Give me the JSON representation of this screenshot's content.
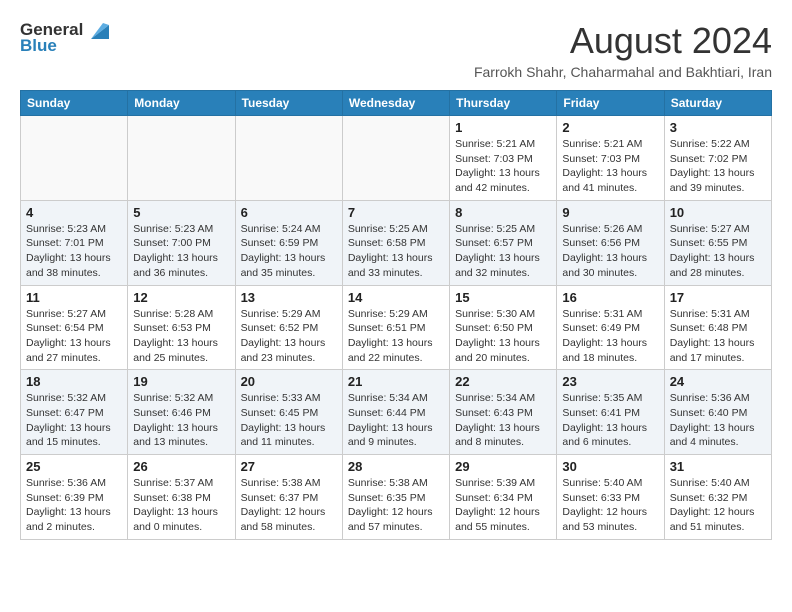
{
  "header": {
    "logo_general": "General",
    "logo_blue": "Blue",
    "month_title": "August 2024",
    "subtitle": "Farrokh Shahr, Chaharmahal and Bakhtiari, Iran"
  },
  "days_of_week": [
    "Sunday",
    "Monday",
    "Tuesday",
    "Wednesday",
    "Thursday",
    "Friday",
    "Saturday"
  ],
  "weeks": [
    [
      {
        "day": "",
        "info": ""
      },
      {
        "day": "",
        "info": ""
      },
      {
        "day": "",
        "info": ""
      },
      {
        "day": "",
        "info": ""
      },
      {
        "day": "1",
        "info": "Sunrise: 5:21 AM\nSunset: 7:03 PM\nDaylight: 13 hours\nand 42 minutes."
      },
      {
        "day": "2",
        "info": "Sunrise: 5:21 AM\nSunset: 7:03 PM\nDaylight: 13 hours\nand 41 minutes."
      },
      {
        "day": "3",
        "info": "Sunrise: 5:22 AM\nSunset: 7:02 PM\nDaylight: 13 hours\nand 39 minutes."
      }
    ],
    [
      {
        "day": "4",
        "info": "Sunrise: 5:23 AM\nSunset: 7:01 PM\nDaylight: 13 hours\nand 38 minutes."
      },
      {
        "day": "5",
        "info": "Sunrise: 5:23 AM\nSunset: 7:00 PM\nDaylight: 13 hours\nand 36 minutes."
      },
      {
        "day": "6",
        "info": "Sunrise: 5:24 AM\nSunset: 6:59 PM\nDaylight: 13 hours\nand 35 minutes."
      },
      {
        "day": "7",
        "info": "Sunrise: 5:25 AM\nSunset: 6:58 PM\nDaylight: 13 hours\nand 33 minutes."
      },
      {
        "day": "8",
        "info": "Sunrise: 5:25 AM\nSunset: 6:57 PM\nDaylight: 13 hours\nand 32 minutes."
      },
      {
        "day": "9",
        "info": "Sunrise: 5:26 AM\nSunset: 6:56 PM\nDaylight: 13 hours\nand 30 minutes."
      },
      {
        "day": "10",
        "info": "Sunrise: 5:27 AM\nSunset: 6:55 PM\nDaylight: 13 hours\nand 28 minutes."
      }
    ],
    [
      {
        "day": "11",
        "info": "Sunrise: 5:27 AM\nSunset: 6:54 PM\nDaylight: 13 hours\nand 27 minutes."
      },
      {
        "day": "12",
        "info": "Sunrise: 5:28 AM\nSunset: 6:53 PM\nDaylight: 13 hours\nand 25 minutes."
      },
      {
        "day": "13",
        "info": "Sunrise: 5:29 AM\nSunset: 6:52 PM\nDaylight: 13 hours\nand 23 minutes."
      },
      {
        "day": "14",
        "info": "Sunrise: 5:29 AM\nSunset: 6:51 PM\nDaylight: 13 hours\nand 22 minutes."
      },
      {
        "day": "15",
        "info": "Sunrise: 5:30 AM\nSunset: 6:50 PM\nDaylight: 13 hours\nand 20 minutes."
      },
      {
        "day": "16",
        "info": "Sunrise: 5:31 AM\nSunset: 6:49 PM\nDaylight: 13 hours\nand 18 minutes."
      },
      {
        "day": "17",
        "info": "Sunrise: 5:31 AM\nSunset: 6:48 PM\nDaylight: 13 hours\nand 17 minutes."
      }
    ],
    [
      {
        "day": "18",
        "info": "Sunrise: 5:32 AM\nSunset: 6:47 PM\nDaylight: 13 hours\nand 15 minutes."
      },
      {
        "day": "19",
        "info": "Sunrise: 5:32 AM\nSunset: 6:46 PM\nDaylight: 13 hours\nand 13 minutes."
      },
      {
        "day": "20",
        "info": "Sunrise: 5:33 AM\nSunset: 6:45 PM\nDaylight: 13 hours\nand 11 minutes."
      },
      {
        "day": "21",
        "info": "Sunrise: 5:34 AM\nSunset: 6:44 PM\nDaylight: 13 hours\nand 9 minutes."
      },
      {
        "day": "22",
        "info": "Sunrise: 5:34 AM\nSunset: 6:43 PM\nDaylight: 13 hours\nand 8 minutes."
      },
      {
        "day": "23",
        "info": "Sunrise: 5:35 AM\nSunset: 6:41 PM\nDaylight: 13 hours\nand 6 minutes."
      },
      {
        "day": "24",
        "info": "Sunrise: 5:36 AM\nSunset: 6:40 PM\nDaylight: 13 hours\nand 4 minutes."
      }
    ],
    [
      {
        "day": "25",
        "info": "Sunrise: 5:36 AM\nSunset: 6:39 PM\nDaylight: 13 hours\nand 2 minutes."
      },
      {
        "day": "26",
        "info": "Sunrise: 5:37 AM\nSunset: 6:38 PM\nDaylight: 13 hours\nand 0 minutes."
      },
      {
        "day": "27",
        "info": "Sunrise: 5:38 AM\nSunset: 6:37 PM\nDaylight: 12 hours\nand 58 minutes."
      },
      {
        "day": "28",
        "info": "Sunrise: 5:38 AM\nSunset: 6:35 PM\nDaylight: 12 hours\nand 57 minutes."
      },
      {
        "day": "29",
        "info": "Sunrise: 5:39 AM\nSunset: 6:34 PM\nDaylight: 12 hours\nand 55 minutes."
      },
      {
        "day": "30",
        "info": "Sunrise: 5:40 AM\nSunset: 6:33 PM\nDaylight: 12 hours\nand 53 minutes."
      },
      {
        "day": "31",
        "info": "Sunrise: 5:40 AM\nSunset: 6:32 PM\nDaylight: 12 hours\nand 51 minutes."
      }
    ]
  ]
}
